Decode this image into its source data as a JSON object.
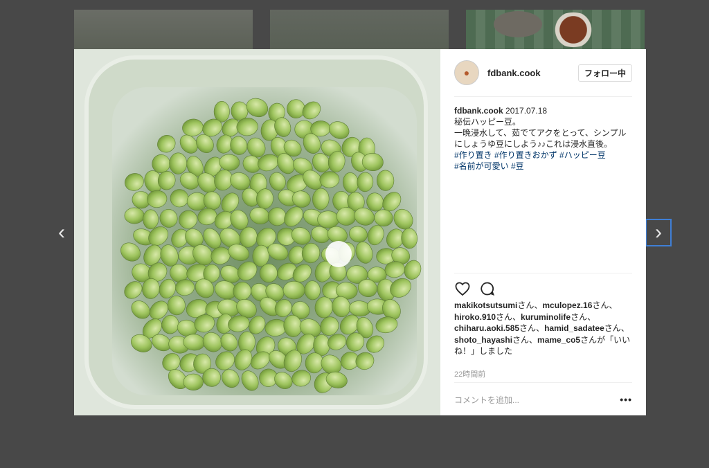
{
  "post": {
    "username": "fdbank.cook",
    "follow_label": "フォロー中",
    "caption": {
      "username": "fdbank.cook",
      "date": "2017.07.18",
      "line1": "秘伝ハッピー豆。",
      "line2": "一晩浸水して、茹でてアクをとって、シンプルにしょうゆ豆にしよう♪♪これは浸水直後。",
      "hashtags_line1": "#作り置き #作り置きおかず #ハッピー豆",
      "hashtags_line2": "#名前が可愛い #豆"
    },
    "likes": {
      "user1": "makikotsutsumi",
      "user2": "mculopez.16",
      "user3": "hiroko.910",
      "user4": "kuruminolife",
      "user5": "chiharu.aoki.585",
      "user6": "hamid_sadatee",
      "user7": "shoto_hayashi",
      "user8": "mame_co5",
      "san": "さん、",
      "san_end": "さん",
      "suffix": "が「いいね！」しました"
    },
    "time_ago": "22時間前",
    "comment_placeholder": "コメントを追加...",
    "more_label": "•••"
  },
  "nav": {
    "prev": "‹",
    "next": "›"
  },
  "icons": {
    "avatar": "avatar-icon",
    "like": "heart-icon",
    "comment": "comment-icon"
  }
}
